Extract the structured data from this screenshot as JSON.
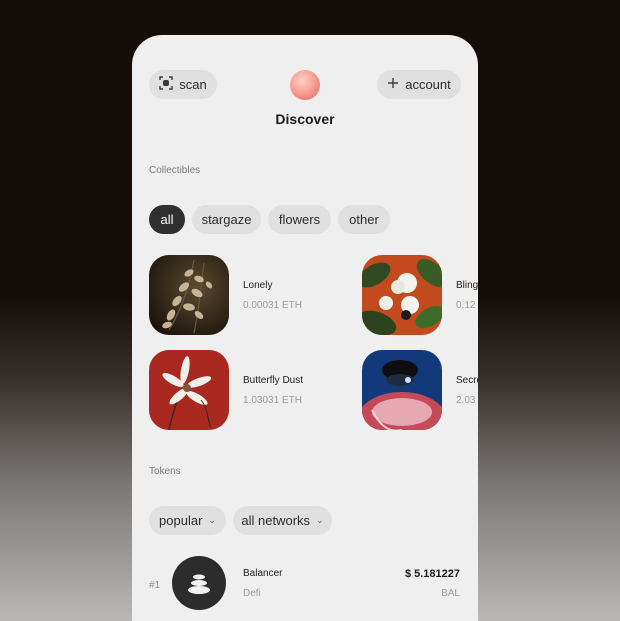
{
  "header": {
    "scan_label": "scan",
    "account_label": "account",
    "title": "Discover",
    "scan_icon": "scan-icon",
    "plus_icon": "plus-icon"
  },
  "collectibles": {
    "section_label": "Collectibles",
    "filters": [
      "all",
      "stargaze",
      "flowers",
      "other"
    ],
    "active_filter": "all",
    "items": [
      {
        "name": "Lonely",
        "price": "0.00031 ETH"
      },
      {
        "name": "Bling",
        "price": "0.12"
      },
      {
        "name": "Butterfly Dust",
        "price": "1.03031 ETH"
      },
      {
        "name": "Secre",
        "price": "2.03"
      }
    ]
  },
  "tokens": {
    "section_label": "Tokens",
    "sort_label": "popular",
    "network_label": "all networks",
    "rows": [
      {
        "rank": "#1",
        "name": "Balancer",
        "category": "Defi",
        "price": "$ 5.181227",
        "symbol": "BAL"
      }
    ]
  },
  "colors": {
    "background_top": "#140d08",
    "card": "#efefef",
    "pill": "#e0e0e0",
    "pill_active": "#2f2f2f",
    "accent": "#f7a196"
  }
}
